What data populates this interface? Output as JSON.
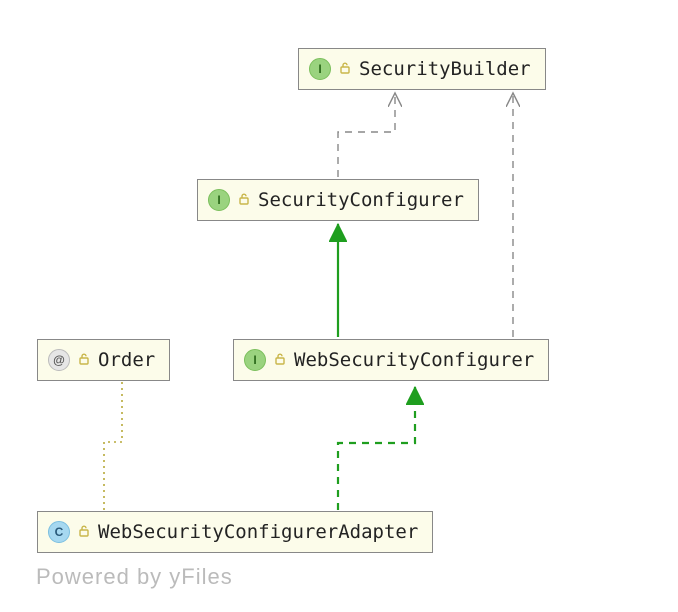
{
  "diagram": {
    "nodes": {
      "securityBuilder": {
        "label": "SecurityBuilder",
        "kind": "I"
      },
      "securityConfigurer": {
        "label": "SecurityConfigurer",
        "kind": "I"
      },
      "webSecurityConfigurer": {
        "label": "WebSecurityConfigurer",
        "kind": "I"
      },
      "order": {
        "label": "Order",
        "kind": "@"
      },
      "webSecurityConfigurerAdapter": {
        "label": "WebSecurityConfigurerAdapter",
        "kind": "C"
      }
    },
    "badges": {
      "I": "I",
      "@": "@",
      "C": "C"
    },
    "edges": [
      {
        "from": "securityConfigurer",
        "to": "securityBuilder",
        "type": "dependency"
      },
      {
        "from": "webSecurityConfigurer",
        "to": "securityBuilder",
        "type": "dependency"
      },
      {
        "from": "webSecurityConfigurer",
        "to": "securityConfigurer",
        "type": "realization"
      },
      {
        "from": "webSecurityConfigurerAdapter",
        "to": "webSecurityConfigurer",
        "type": "realization"
      },
      {
        "from": "webSecurityConfigurerAdapter",
        "to": "order",
        "type": "annotation"
      }
    ],
    "footer": "Powered by yFiles"
  }
}
